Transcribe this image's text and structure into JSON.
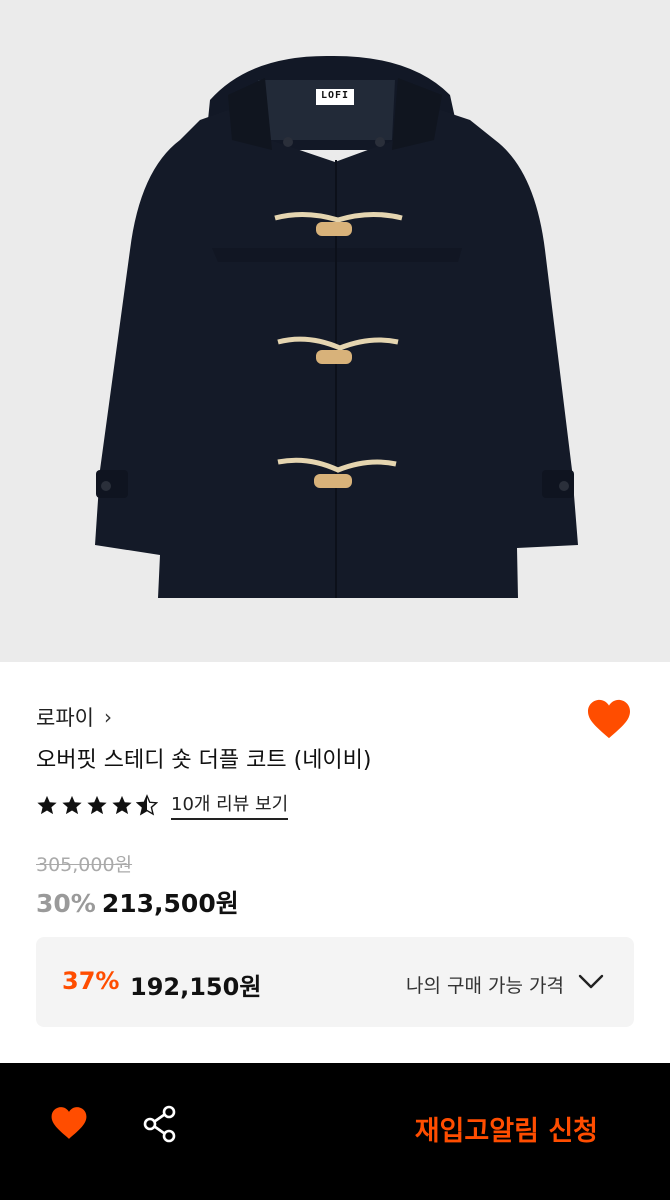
{
  "product_image": {
    "logo_text": "LOFI",
    "colors": {
      "background": "#ebebeb",
      "coat": "#151b2a"
    }
  },
  "brand": {
    "name": "로파이"
  },
  "product": {
    "title": "오버핏 스테디 숏 더플 코트 (네이비)"
  },
  "rating": {
    "value": 4.5,
    "max": 5,
    "review_link": "10개 리뷰 보기"
  },
  "price": {
    "original": "305,000원",
    "discount_rate": "30%",
    "sale_price": "213,500원"
  },
  "my_price": {
    "discount_rate": "37%",
    "price": "192,150원",
    "label": "나의 구매 가능 가격"
  },
  "bottom_bar": {
    "cta": "재입고알림 신청"
  },
  "colors": {
    "accent": "#ff4d00",
    "text": "#111111",
    "muted": "#9a9a9a"
  }
}
